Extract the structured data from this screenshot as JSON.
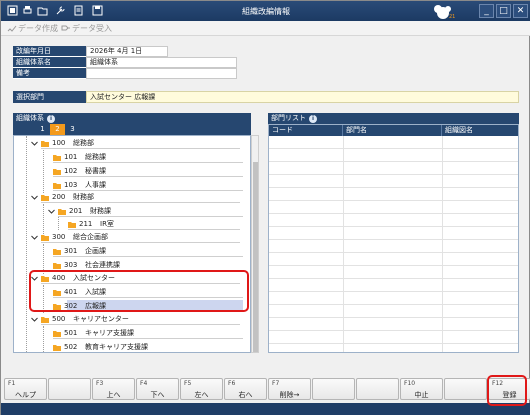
{
  "window": {
    "title": "組織改編情報"
  },
  "toolbar": {
    "items": [
      {
        "label": "データ作成",
        "icon": "create-data-icon"
      },
      {
        "label": "データ受入",
        "icon": "import-data-icon"
      }
    ]
  },
  "form": {
    "date_label": "改編年月日",
    "date_value": "2026年 4月 1日",
    "system_name_label": "組織体系名",
    "system_name_value": "組織体系",
    "remarks_label": "備考",
    "remarks_value": ""
  },
  "selected_dept": {
    "label": "選択部門",
    "value": "入試センター 広報課"
  },
  "tree_panel": {
    "title": "組織体系",
    "tabs": [
      "1",
      "2",
      "3"
    ],
    "active_tab": "2",
    "nodes": [
      {
        "code": "100",
        "name": "総務部"
      },
      {
        "code": "101",
        "name": "総務課"
      },
      {
        "code": "102",
        "name": "秘書課"
      },
      {
        "code": "103",
        "name": "人事課"
      },
      {
        "code": "200",
        "name": "財務部"
      },
      {
        "code": "201",
        "name": "財務課"
      },
      {
        "code": "211",
        "name": "IR室"
      },
      {
        "code": "300",
        "name": "総合企画部"
      },
      {
        "code": "301",
        "name": "企画課"
      },
      {
        "code": "303",
        "name": "社会連携課"
      },
      {
        "code": "400",
        "name": "入試センター"
      },
      {
        "code": "401",
        "name": "入試課"
      },
      {
        "code": "302",
        "name": "広報課"
      },
      {
        "code": "500",
        "name": "キャリアセンター"
      },
      {
        "code": "501",
        "name": "キャリア支援課"
      },
      {
        "code": "502",
        "name": "教育キャリア支援課"
      }
    ]
  },
  "list_panel": {
    "title": "部門リスト",
    "columns": [
      "コード",
      "部門名",
      "組織図名"
    ]
  },
  "fkeys": [
    {
      "num": "F1",
      "label": "ヘルプ"
    },
    {
      "num": "",
      "label": ""
    },
    {
      "num": "F3",
      "label": "上へ"
    },
    {
      "num": "F4",
      "label": "下へ"
    },
    {
      "num": "F5",
      "label": "左へ"
    },
    {
      "num": "F6",
      "label": "右へ"
    },
    {
      "num": "F7",
      "label": "削除→"
    },
    {
      "num": "",
      "label": ""
    },
    {
      "num": "",
      "label": ""
    },
    {
      "num": "F10",
      "label": "中止"
    },
    {
      "num": "",
      "label": ""
    },
    {
      "num": "F12",
      "label": "登録"
    }
  ],
  "colors": {
    "navy": "#264770",
    "accent_tab": "#f39a1c",
    "highlight": "#e01818"
  }
}
